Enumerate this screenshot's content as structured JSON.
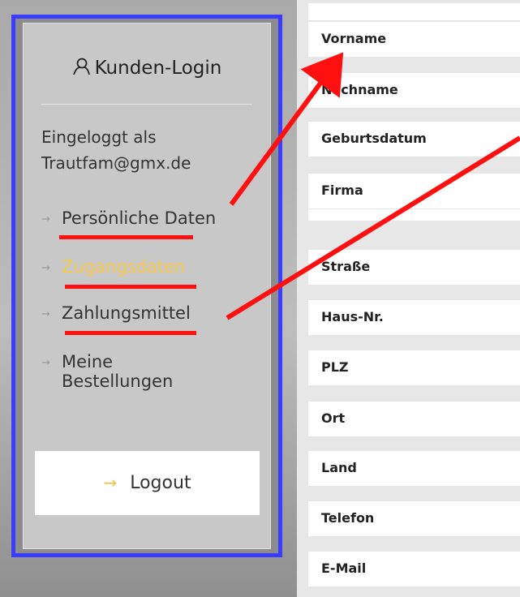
{
  "sidebar": {
    "title": "Kunden-Login",
    "logged_in_label": "Eingeloggt als",
    "email": "Trautfam@gmx.de",
    "nav": [
      {
        "label": "Persönliche Daten",
        "arrow": "→"
      },
      {
        "label": "Zugangsdaten",
        "arrow": "→",
        "active": true
      },
      {
        "label": "Zahlungsmittel",
        "arrow": "→"
      },
      {
        "label": "Meine\nBestellungen",
        "arrow": "→"
      }
    ],
    "logout": {
      "arrow": "→",
      "label": "Logout"
    }
  },
  "form": {
    "fields": [
      "Vorname",
      "Nachname",
      "Geburtsdatum",
      "Firma",
      "",
      "Straße",
      "Haus-Nr.",
      "PLZ",
      "Ort",
      "Land",
      "Telefon",
      "E-Mail"
    ]
  },
  "colors": {
    "border": "#3a3cff",
    "annotation": "#ff1010",
    "active": "#f7c84a"
  }
}
